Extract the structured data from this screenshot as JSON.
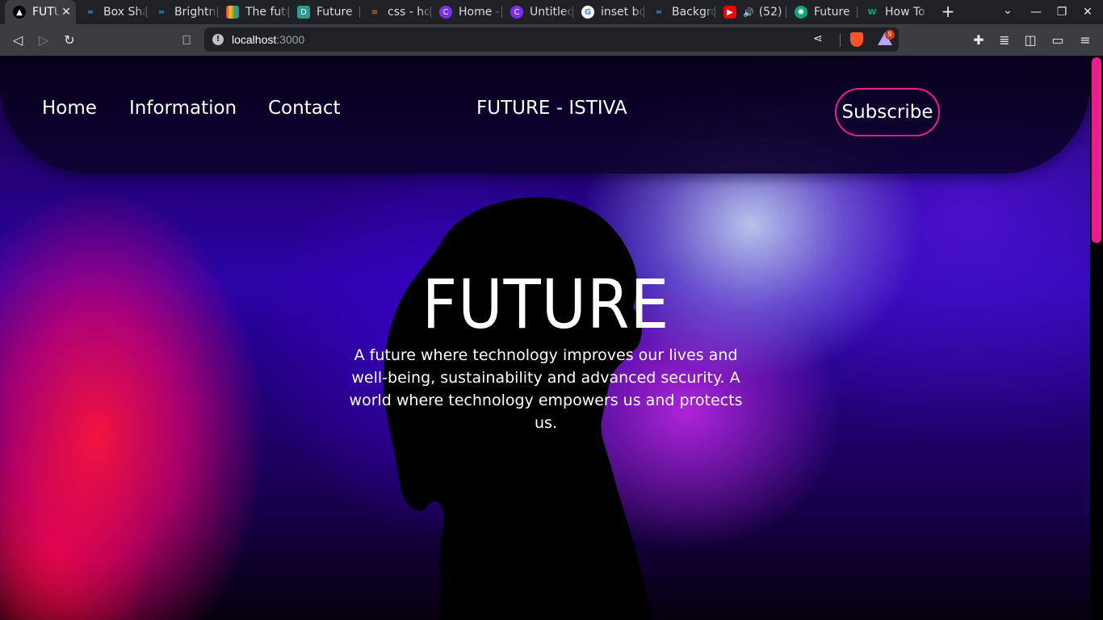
{
  "tabs": [
    {
      "label": "FUTURE",
      "active": true
    },
    {
      "label": "Box Shadow"
    },
    {
      "label": "Brightness"
    },
    {
      "label": "The future"
    },
    {
      "label": "Future"
    },
    {
      "label": "css - how"
    },
    {
      "label": "Home -"
    },
    {
      "label": "Untitled"
    },
    {
      "label": "inset box"
    },
    {
      "label": "Background"
    },
    {
      "label": "(52)"
    },
    {
      "label": "Future"
    },
    {
      "label": "How To"
    }
  ],
  "toolbar": {
    "url_host": "localhost",
    "url_port": ":3000",
    "rewards_count": "9"
  },
  "page": {
    "nav": {
      "home": "Home",
      "information": "Information",
      "contact": "Contact",
      "brand": "FUTURE - ISTIVA",
      "subscribe": "Subscribe"
    },
    "hero": {
      "title": "FUTURE",
      "description": "A future where technology improves our lives and well-being, sustainability and advanced security. A world where technology empowers us and protects us."
    }
  },
  "colors": {
    "accent_pink": "#ec1c8c",
    "tab_bar": "#202124",
    "toolbar": "#3c3d41"
  }
}
